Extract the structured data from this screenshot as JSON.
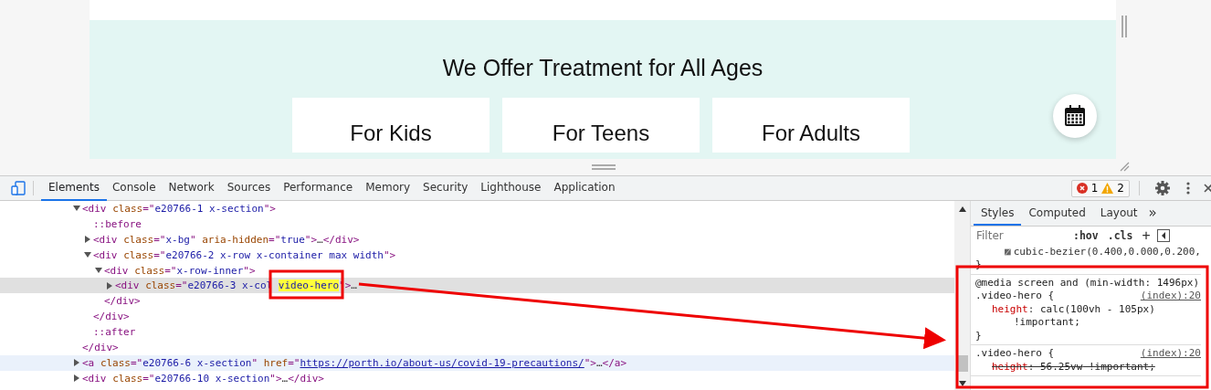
{
  "preview": {
    "heading": "We Offer Treatment for All Ages",
    "cards": [
      "For Kids",
      "For Teens",
      "For Adults"
    ]
  },
  "devtools": {
    "tabs": [
      {
        "label": "Elements",
        "selected": true
      },
      {
        "label": "Console",
        "selected": false
      },
      {
        "label": "Network",
        "selected": false
      },
      {
        "label": "Sources",
        "selected": false
      },
      {
        "label": "Performance",
        "selected": false
      },
      {
        "label": "Memory",
        "selected": false
      },
      {
        "label": "Security",
        "selected": false
      },
      {
        "label": "Lighthouse",
        "selected": false
      },
      {
        "label": "Application",
        "selected": false
      }
    ],
    "errors": "1",
    "warnings": "2",
    "dom_tree": [
      {
        "kind": "element",
        "expanded": true,
        "selected": false,
        "hovered": false,
        "parts": [
          {
            "kind": "tag",
            "text": "<div "
          },
          {
            "kind": "attr",
            "text": "class"
          },
          {
            "kind": "tag",
            "text": "=\""
          },
          {
            "kind": "value",
            "text": "e20766-1 x-section"
          },
          {
            "kind": "tag",
            "text": "\">"
          }
        ],
        "close": "</div>",
        "children": [
          {
            "kind": "pseudo",
            "text": "::before"
          },
          {
            "kind": "element",
            "expanded": false,
            "selected": false,
            "hovered": false,
            "parts": [
              {
                "kind": "tag",
                "text": "<div "
              },
              {
                "kind": "attr",
                "text": "class"
              },
              {
                "kind": "tag",
                "text": "=\""
              },
              {
                "kind": "value",
                "text": "x-bg"
              },
              {
                "kind": "tag",
                "text": "\" "
              },
              {
                "kind": "attr",
                "text": "aria-hidden"
              },
              {
                "kind": "tag",
                "text": "=\""
              },
              {
                "kind": "value",
                "text": "true"
              },
              {
                "kind": "tag",
                "text": "\">"
              },
              {
                "kind": "plain",
                "text": "…"
              },
              {
                "kind": "tag",
                "text": "</div>"
              }
            ]
          },
          {
            "kind": "element",
            "expanded": true,
            "selected": false,
            "hovered": false,
            "parts": [
              {
                "kind": "tag",
                "text": "<div "
              },
              {
                "kind": "attr",
                "text": "class"
              },
              {
                "kind": "tag",
                "text": "=\""
              },
              {
                "kind": "value",
                "text": "e20766-2 x-row x-container max width"
              },
              {
                "kind": "tag",
                "text": "\">"
              }
            ],
            "close": "</div>",
            "children": [
              {
                "kind": "element",
                "expanded": true,
                "selected": false,
                "hovered": false,
                "parts": [
                  {
                    "kind": "tag",
                    "text": "<div "
                  },
                  {
                    "kind": "attr",
                    "text": "class"
                  },
                  {
                    "kind": "tag",
                    "text": "=\""
                  },
                  {
                    "kind": "value",
                    "text": "x-row-inner"
                  },
                  {
                    "kind": "tag",
                    "text": "\">"
                  }
                ],
                "close": "</div>",
                "children": [
                  {
                    "kind": "element",
                    "expanded": false,
                    "selected": true,
                    "hovered": false,
                    "parts": [
                      {
                        "kind": "tag",
                        "text": "<div "
                      },
                      {
                        "kind": "attr",
                        "text": "class"
                      },
                      {
                        "kind": "tag",
                        "text": "=\""
                      },
                      {
                        "kind": "value",
                        "text": "e20766-3 x-col "
                      },
                      {
                        "kind": "highlight",
                        "text": "video-hero"
                      },
                      {
                        "kind": "tag",
                        "text": "\">"
                      },
                      {
                        "kind": "plain",
                        "text": "…"
                      }
                    ]
                  }
                ]
              }
            ]
          },
          {
            "kind": "pseudo",
            "text": "::after"
          }
        ]
      },
      {
        "kind": "element",
        "expanded": false,
        "selected": false,
        "hovered": true,
        "parts": [
          {
            "kind": "tag",
            "text": "<a "
          },
          {
            "kind": "attr",
            "text": "class"
          },
          {
            "kind": "tag",
            "text": "=\""
          },
          {
            "kind": "value",
            "text": "e20766-6 x-section"
          },
          {
            "kind": "tag",
            "text": "\" "
          },
          {
            "kind": "attr",
            "text": "href"
          },
          {
            "kind": "tag",
            "text": "=\""
          },
          {
            "kind": "link",
            "text": "https://porth.io/about-us/covid-19-precautions/"
          },
          {
            "kind": "tag",
            "text": "\">"
          },
          {
            "kind": "plain",
            "text": "…"
          },
          {
            "kind": "tag",
            "text": "</a>"
          }
        ]
      },
      {
        "kind": "element",
        "expanded": false,
        "selected": false,
        "hovered": false,
        "parts": [
          {
            "kind": "tag",
            "text": "<div "
          },
          {
            "kind": "attr",
            "text": "class"
          },
          {
            "kind": "tag",
            "text": "=\""
          },
          {
            "kind": "value",
            "text": "e20766-10 x-section"
          },
          {
            "kind": "tag",
            "text": "\">"
          },
          {
            "kind": "plain",
            "text": "…"
          },
          {
            "kind": "tag",
            "text": "</div>"
          }
        ]
      }
    ],
    "side_tabs": [
      {
        "label": "Styles",
        "selected": true
      },
      {
        "label": "Computed",
        "selected": false
      },
      {
        "label": "Layout",
        "selected": false
      }
    ],
    "more_tabs": "»",
    "filter": {
      "placeholder": "Filter"
    },
    "hov": ":hov",
    "cls": ".cls",
    "add": "+",
    "prev_rule": {
      "value": "cubic-bezier(0.400,0.000,0.200,",
      "close": "}"
    },
    "rules": [
      {
        "media": "@media screen and (min-width: 1496px)",
        "selector": ".video-hero {",
        "source": "(index):20",
        "declarations": [
          {
            "property": "height",
            "separator": ":",
            "value": "calc(100vh - 105px)",
            "important": "!important;",
            "overridden": false
          }
        ],
        "close": "}"
      },
      {
        "selector": ".video-hero {",
        "source": "(index):20",
        "declarations": [
          {
            "property": "height",
            "separator": ":",
            "value": "56.25vw",
            "important": "!important;",
            "overridden": true
          }
        ]
      }
    ]
  }
}
